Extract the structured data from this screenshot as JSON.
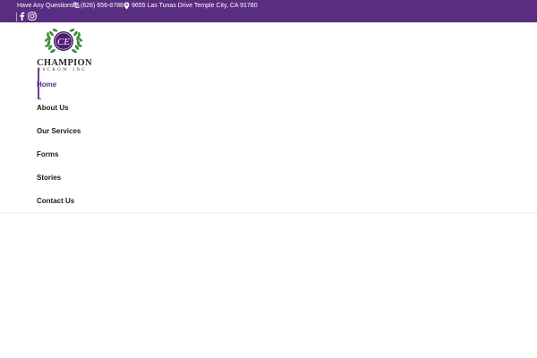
{
  "topbar": {
    "question": "Have Any Questions?",
    "phone": "(626) 656-8788",
    "address": "9655 Las Tunas Drive Temple City, CA 91780",
    "phone_icon": "phone-icon",
    "location_icon": "map-pin-icon",
    "background": "#5a2d82"
  },
  "social": {
    "facebook_icon": "facebook-icon",
    "instagram_icon": "instagram-icon"
  },
  "logo": {
    "monogram": "CE",
    "name": "CHAMPION",
    "subtitle": "ESCROW·INC",
    "wreath_color": "#3f8f3a",
    "badge_color": "#4a1f6b"
  },
  "nav": {
    "items": [
      {
        "label": "Home"
      },
      {
        "label": "About Us"
      },
      {
        "label": "Our Services"
      },
      {
        "label": "Forms"
      },
      {
        "label": "Stories"
      },
      {
        "label": "Contact Us"
      }
    ],
    "active": "Home",
    "accent": "#5a2d82"
  }
}
